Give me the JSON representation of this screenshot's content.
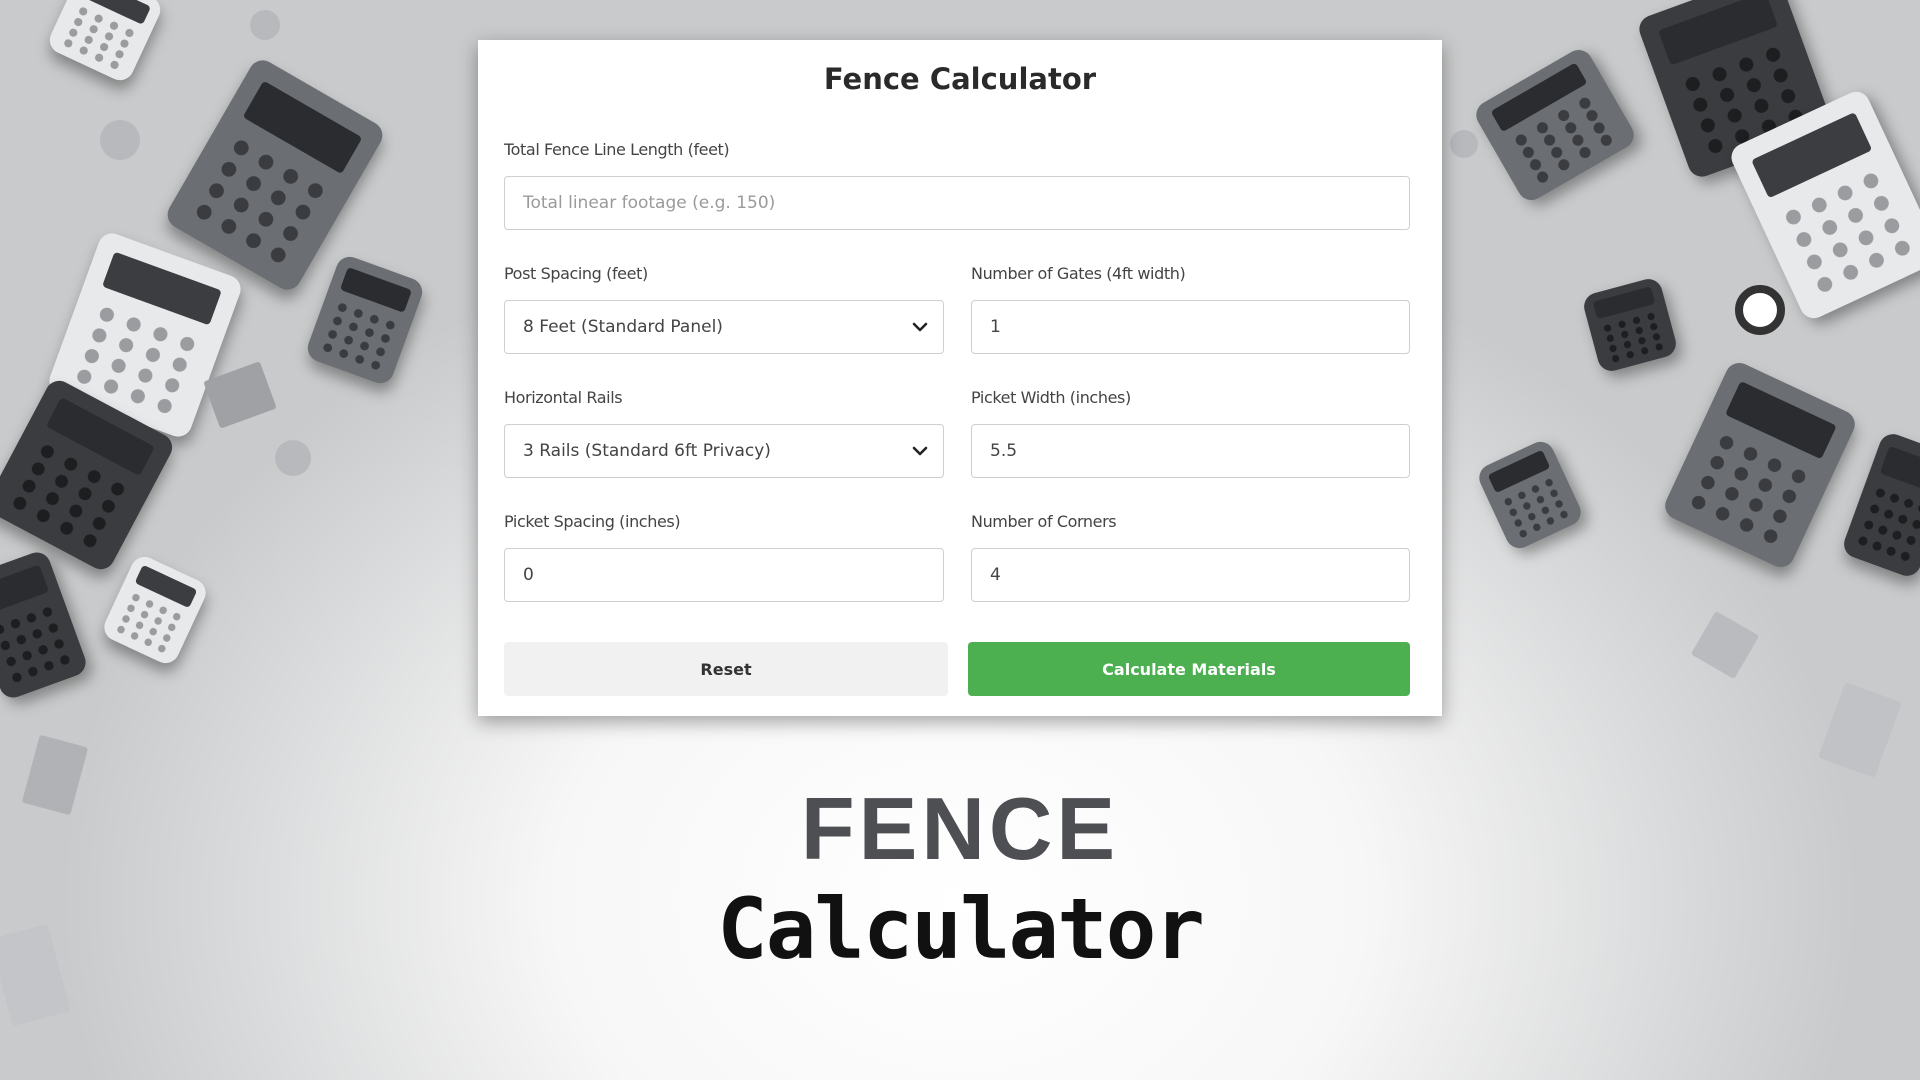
{
  "form": {
    "title": "Fence Calculator",
    "total_length": {
      "label": "Total Fence Line Length (feet)",
      "placeholder": "Total linear footage (e.g. 150)",
      "value": ""
    },
    "post_spacing": {
      "label": "Post Spacing (feet)",
      "selected": "8 Feet (Standard Panel)"
    },
    "gates": {
      "label": "Number of Gates (4ft width)",
      "value": "1"
    },
    "rails": {
      "label": "Horizontal Rails",
      "selected": "3 Rails (Standard 6ft Privacy)"
    },
    "picket_width": {
      "label": "Picket Width (inches)",
      "value": "5.5"
    },
    "picket_spacing": {
      "label": "Picket Spacing (inches)",
      "value": "0"
    },
    "corners": {
      "label": "Number of Corners",
      "value": "4"
    },
    "reset_label": "Reset",
    "calculate_label": "Calculate Materials"
  },
  "banner": {
    "line1": "FENCE",
    "line2": "Calculator"
  },
  "colors": {
    "accent": "#4caf50",
    "reset_bg": "#f1f1f1",
    "heading_gray": "#4d4f53"
  },
  "icons": {
    "dropdown": "chevron-down-icon"
  }
}
